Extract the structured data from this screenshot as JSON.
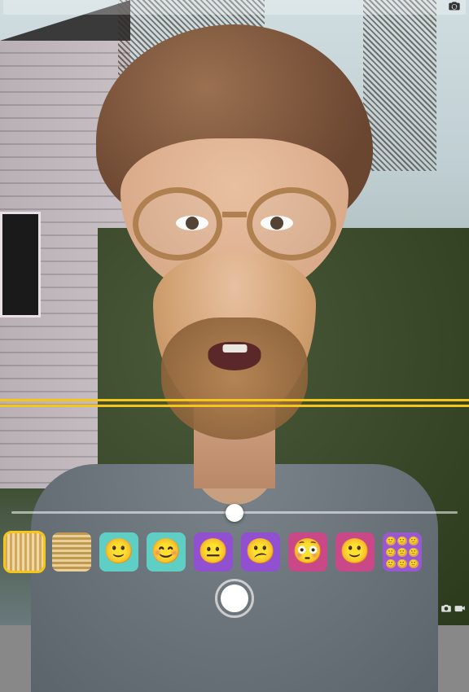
{
  "colors": {
    "accent": "#f5c518",
    "shutter": "#ffffff"
  },
  "slider": {
    "value": 50,
    "min": 0,
    "max": 100
  },
  "effects": {
    "selected_index": 0,
    "items": [
      {
        "id": "stretch-vertical",
        "label": "Vertical Squeeze"
      },
      {
        "id": "stretch-horizontal",
        "label": "Horizontal Squeeze"
      },
      {
        "id": "face-teal-1",
        "label": "Cartoon Face 1"
      },
      {
        "id": "face-teal-2",
        "label": "Cartoon Face 2"
      },
      {
        "id": "face-purple-1",
        "label": "Shrunk Face"
      },
      {
        "id": "face-purple-2",
        "label": "Purple Warp"
      },
      {
        "id": "face-magenta",
        "label": "Big Eyes"
      },
      {
        "id": "face-small",
        "label": "Tiny Head"
      },
      {
        "id": "grid-multi",
        "label": "Nine Faces"
      }
    ]
  },
  "controls": {
    "flip_camera": "Flip Camera",
    "shutter": "Capture",
    "mode_photo": "Photo",
    "mode_video": "Video"
  }
}
